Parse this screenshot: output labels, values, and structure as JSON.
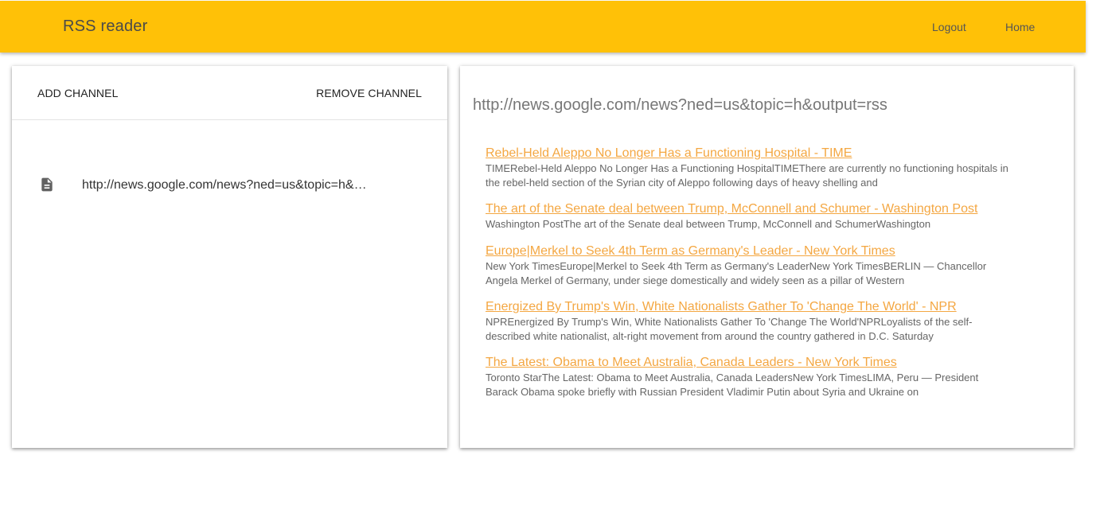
{
  "header": {
    "title": "RSS reader",
    "nav": {
      "logout": "Logout",
      "home": "Home"
    },
    "accent_color": "#ffc107"
  },
  "channels_panel": {
    "add_label": "ADD CHANNEL",
    "remove_label": "REMOVE CHANNEL",
    "channels": [
      {
        "icon": "document-icon",
        "url": "http://news.google.com/news?ned=us&topic=h&output=rss"
      }
    ]
  },
  "feed_panel": {
    "url": "http://news.google.com/news?ned=us&topic=h&output=rss",
    "link_color": "#f4a742",
    "items": [
      {
        "title": "Rebel-Held Aleppo No Longer Has a Functioning Hospital - TIME",
        "description": "TIMERebel-Held Aleppo No Longer Has a Functioning HospitalTIMEThere are currently no functioning hospitals in the rebel-held section of the Syrian city of Aleppo following days of heavy shelling and"
      },
      {
        "title": "The art of the Senate deal between Trump, McConnell and Schumer - Washington Post",
        "description": "Washington PostThe art of the Senate deal between Trump, McConnell and SchumerWashington"
      },
      {
        "title": "Europe|Merkel to Seek 4th Term as Germany's Leader - New York Times",
        "description": "New York TimesEurope|Merkel to Seek 4th Term as Germany's LeaderNew York TimesBERLIN — Chancellor Angela Merkel of Germany, under siege domestically and widely seen as a pillar of Western"
      },
      {
        "title": "Energized By Trump's Win, White Nationalists Gather To 'Change The World' - NPR",
        "description": "NPREnergized By Trump's Win, White Nationalists Gather To 'Change The World'NPRLoyalists of the self-described white nationalist, alt-right movement from around the country gathered in D.C. Saturday"
      },
      {
        "title": "The Latest: Obama to Meet Australia, Canada Leaders - New York Times",
        "description": "Toronto StarThe Latest: Obama to Meet Australia, Canada LeadersNew York TimesLIMA, Peru — President Barack Obama spoke briefly with Russian President Vladimir Putin about Syria and Ukraine on"
      }
    ]
  }
}
